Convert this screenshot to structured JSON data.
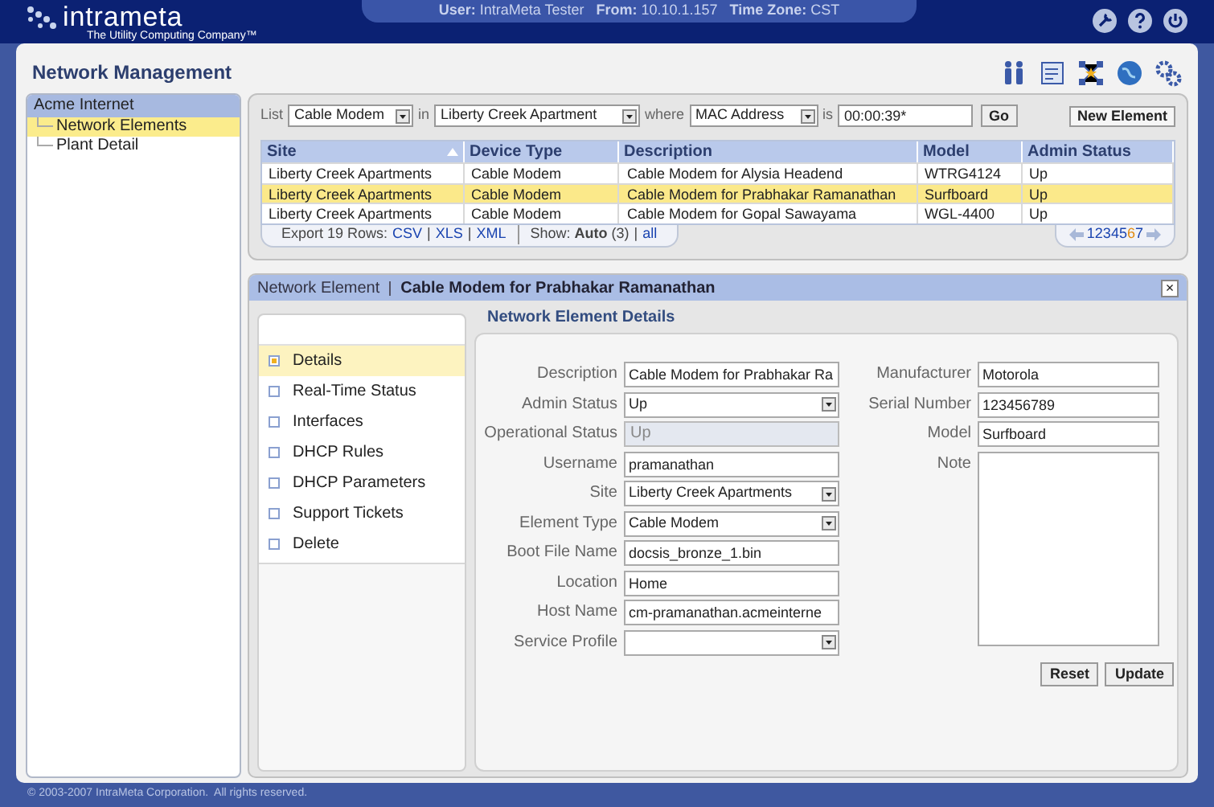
{
  "header": {
    "logo": "intrameta",
    "tagline": "The Utility Computing Company™",
    "user_label": "User:",
    "user": "IntraMeta Tester",
    "from_label": "From:",
    "from": "10.10.1.157",
    "tz_label": "Time Zone:",
    "tz": "CST"
  },
  "page_title": "Network Management",
  "sidebar": {
    "title": "Acme Internet",
    "items": [
      {
        "label": "Network Elements",
        "selected": true
      },
      {
        "label": "Plant Detail",
        "selected": false
      }
    ]
  },
  "filter": {
    "list_label": "List",
    "type": "Cable Modem",
    "in_label": "in",
    "site": "Liberty Creek Apartment",
    "where_label": "where",
    "field": "MAC Address",
    "is_label": "is",
    "value": "00:00:39*",
    "go": "Go",
    "new": "New Element"
  },
  "table": {
    "columns": [
      "Site",
      "Device Type",
      "Description",
      "Model",
      "Admin Status"
    ],
    "rows": [
      {
        "cells": [
          "Liberty Creek Apartments",
          "Cable Modem",
          "Cable Modem for Alysia Headend",
          "WTRG4124",
          "Up"
        ],
        "selected": false
      },
      {
        "cells": [
          "Liberty Creek Apartments",
          "Cable Modem",
          "Cable Modem for Prabhakar Ramanathan",
          "Surfboard",
          "Up"
        ],
        "selected": true
      },
      {
        "cells": [
          "Liberty Creek Apartments",
          "Cable Modem",
          "Cable Modem for Gopal Sawayama",
          "WGL-4400",
          "Up"
        ],
        "selected": false
      }
    ],
    "separator": "|",
    "export_label": "Export 19 Rows:",
    "exports": [
      "CSV",
      "XLS",
      "XML"
    ],
    "show_label": "Show:",
    "show_value": "Auto",
    "show_count": "(3)",
    "show_all": "all",
    "pages": [
      {
        "label": "1",
        "selected": false
      },
      {
        "label": "2",
        "selected": false
      },
      {
        "label": "3",
        "selected": false
      },
      {
        "label": "4",
        "selected": false
      },
      {
        "label": "5",
        "selected": false
      },
      {
        "label": "6",
        "selected": true
      },
      {
        "label": "7",
        "selected": false
      }
    ]
  },
  "detail": {
    "kind_label": "Network Element",
    "title": "Cable Modem for Prabhakar Ramanathan",
    "close": "×",
    "nav": [
      {
        "label": "Details",
        "selected": true
      },
      {
        "label": "Real-Time Status",
        "selected": false
      },
      {
        "label": "Interfaces",
        "selected": false
      },
      {
        "label": "DHCP Rules",
        "selected": false
      },
      {
        "label": "DHCP Parameters",
        "selected": false
      },
      {
        "label": "Support Tickets",
        "selected": false
      },
      {
        "label": "Delete",
        "selected": false
      }
    ],
    "heading": "Network Element Details",
    "left_fields": [
      {
        "label": "Description",
        "kind": "text",
        "value": "Cable Modem for Prabhakar Ra"
      },
      {
        "label": "Admin Status",
        "kind": "select",
        "value": "Up"
      },
      {
        "label": "Operational Status",
        "kind": "readonly",
        "value": "Up"
      },
      {
        "label": "Username",
        "kind": "text",
        "value": "pramanathan"
      },
      {
        "label": "Site",
        "kind": "select",
        "value": "Liberty Creek Apartments"
      },
      {
        "label": "Element Type",
        "kind": "select",
        "value": "Cable Modem"
      },
      {
        "label": "Boot File Name",
        "kind": "text",
        "value": "docsis_bronze_1.bin"
      },
      {
        "label": "Location",
        "kind": "text",
        "value": "Home"
      },
      {
        "label": "Host Name",
        "kind": "text",
        "value": "cm-pramanathan.acmeinterne"
      },
      {
        "label": "Service Profile",
        "kind": "select"
      }
    ],
    "right_fields": [
      {
        "label": "Manufacturer",
        "kind": "text",
        "value": "Motorola"
      },
      {
        "label": "Serial Number",
        "kind": "text",
        "value": "123456789"
      },
      {
        "label": "Model",
        "kind": "text",
        "value": "Surfboard"
      },
      {
        "label": "Note",
        "kind": "textarea"
      }
    ],
    "buttons": [
      "Reset",
      "Update"
    ]
  },
  "footer": "© 2003-2007 IntraMeta Corporation.  All rights reserved."
}
